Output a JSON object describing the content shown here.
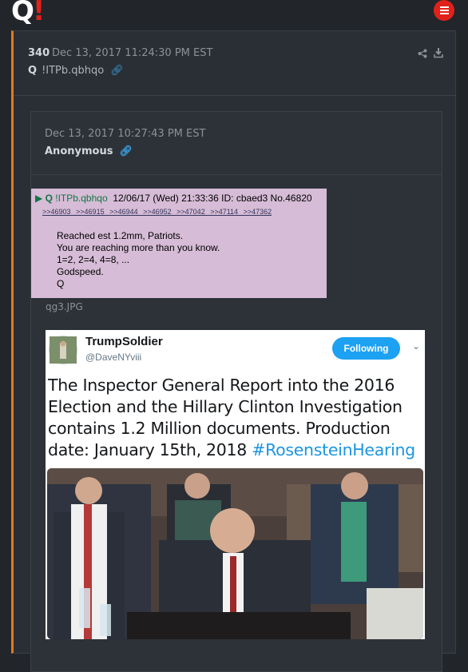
{
  "header": {
    "logo_letter": "Q",
    "logo_mark": "!"
  },
  "post": {
    "number": "340",
    "date": "Dec 13, 2017 11:24:30 PM EST",
    "author": "Q",
    "tripcode": "!ITPb.qbhqo"
  },
  "quoted": {
    "date": "Dec 13, 2017 10:27:43 PM EST",
    "author": "Anonymous",
    "image1": {
      "header_name": "Q",
      "header_trip": "!ITPb.qbhqo",
      "header_rest": "12/06/17 (Wed) 21:33:36 ID: cbaed3 No.46820",
      "refs": ">>46903 >>46915 >>46944 >>46952 >>47042 >>47114 >>47362",
      "lines": [
        "Reached est 1.2mm, Patriots.",
        "You are reaching more than you know.",
        "1=2, 2=4, 4=8, ...",
        "Godspeed.",
        "Q"
      ],
      "caption": "qg3.JPG"
    },
    "tweet": {
      "name": "TrumpSoldier",
      "handle": "@DaveNYviii",
      "follow_label": "Following",
      "text": "The Inspector General Report into the 2016 Election and the Hillary Clinton Investigation contains 1.2 Million documents.  Production date: January 15th, 2018 ",
      "hashtag": "#RosensteinHearing"
    }
  },
  "colors": {
    "accent": "#e0221a",
    "link": "#3a9fe0",
    "post_border": "#e07a20",
    "twitter_blue": "#1da1f2"
  },
  "icons": [
    "menu-icon",
    "link-icon",
    "share-icon",
    "download-icon",
    "chevron-down-icon"
  ]
}
